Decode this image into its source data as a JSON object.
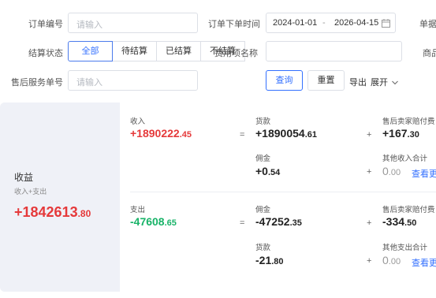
{
  "filters": {
    "order_no": {
      "label": "订单编号",
      "placeholder": "请输入"
    },
    "order_time": {
      "label": "订单下单时间",
      "start": "2024-01-01",
      "end": "2026-04-15",
      "separator": "-"
    },
    "cut_label_1": "单据",
    "settle_status": {
      "label": "结算状态",
      "options": [
        "全部",
        "待结算",
        "已结算",
        "不结算"
      ],
      "selected": "全部"
    },
    "fee_item": {
      "label": "费用项名称"
    },
    "cut_label_2": "商品",
    "after_sale_no": {
      "label": "售后服务单号",
      "placeholder": "请输入"
    },
    "buttons": {
      "query": "查询",
      "reset": "重置",
      "export": "导出",
      "expand": "展开"
    }
  },
  "summary": {
    "title": "收益",
    "subtitle": "收入+支出",
    "total_int": "+1842613",
    "total_dec": ".80",
    "income": {
      "label": "收入",
      "int": "+1890222",
      "dec": ".45",
      "eq": "=",
      "goods": {
        "label": "货款",
        "int": "+1890054",
        "dec": ".61"
      },
      "plus1": "+",
      "comp": {
        "label": "售后卖家赔付费",
        "int": "+167",
        "dec": ".30"
      },
      "commission": {
        "label": "佣金",
        "int": "+0",
        "dec": ".54"
      },
      "plus2": "+",
      "other": {
        "label": "其他收入合计",
        "int": "0",
        "dec": ".00",
        "link": "查看更"
      }
    },
    "expense": {
      "label": "支出",
      "int": "-47608",
      "dec": ".65",
      "eq": "=",
      "commission": {
        "label": "佣金",
        "int": "-47252",
        "dec": ".35"
      },
      "plus1": "+",
      "comp": {
        "label": "售后卖家赔付费",
        "int": "-334",
        "dec": ".50"
      },
      "goods": {
        "label": "货款",
        "int": "-21",
        "dec": ".80"
      },
      "plus2": "+",
      "other": {
        "label": "其他支出合计",
        "int": "0",
        "dec": ".00",
        "link": "查看更"
      }
    }
  },
  "colors": {
    "accent": "#3370ff",
    "positive": "#e5393a",
    "negative": "#18b368"
  },
  "icons": {
    "calendar": "calendar-icon",
    "expand": "chevron-down-icon"
  }
}
